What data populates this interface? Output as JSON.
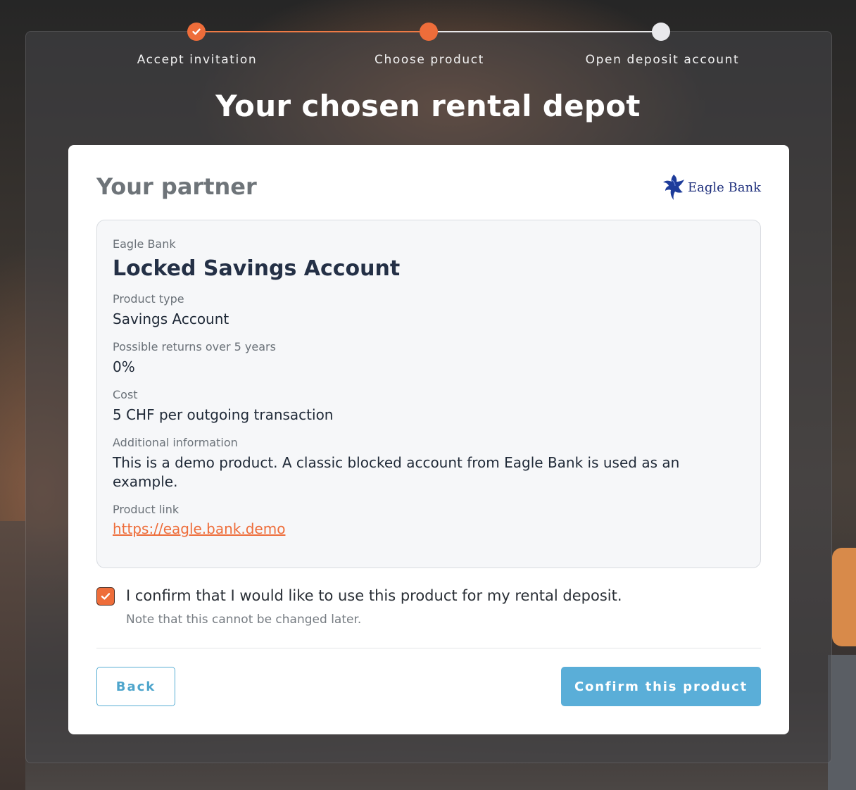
{
  "stepper": {
    "steps": [
      {
        "label": "Accept invitation",
        "state": "done"
      },
      {
        "label": "Choose product",
        "state": "current"
      },
      {
        "label": "Open deposit account",
        "state": "upcoming"
      }
    ]
  },
  "page_title": "Your chosen rental depot",
  "card": {
    "title": "Your partner",
    "logo_text": "Eagle Bank",
    "product": {
      "bank": "Eagle Bank",
      "name": "Locked Savings Account",
      "fields": [
        {
          "label": "Product type",
          "value": "Savings Account"
        },
        {
          "label": "Possible returns over 5 years",
          "value": "0%"
        },
        {
          "label": "Cost",
          "value": "5 CHF per outgoing transaction"
        },
        {
          "label": "Additional information",
          "value": "This is a demo product. A classic blocked account from Eagle Bank is used as an example."
        }
      ],
      "link_label": "Product link",
      "link_text": "https://eagle.bank.demo"
    },
    "confirm": {
      "checked": true,
      "text": "I confirm that I would like to use this product for my rental deposit.",
      "note": "Note that this cannot be changed later."
    },
    "buttons": {
      "back": "Back",
      "confirm": "Confirm this product"
    }
  },
  "colors": {
    "accent": "#ee6d3a",
    "primary_button": "#5aaed8",
    "logo_blue": "#1e2f7c"
  }
}
